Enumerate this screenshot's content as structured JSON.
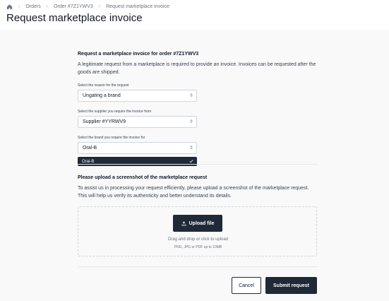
{
  "breadcrumb": {
    "items": [
      "Orders",
      "Order #7Z1YWV3",
      "Request marketplace invoice"
    ]
  },
  "page_title": "Request marketplace invoice",
  "form": {
    "heading": "Request a marketplace invoice for order #7Z1YWV3",
    "description": "A legitimate request from a marketplace is required to provide an invoice. Invoices can be requested after the goods are shipped.",
    "reason": {
      "label": "Select the reason for the request",
      "value": "Ungating a brand"
    },
    "supplier": {
      "label": "Select the supplier you require the invoice from",
      "value": "Supplier #YYRWV9"
    },
    "brand": {
      "label": "Select the brand you require the invoice for",
      "value": "Oral-B",
      "options": [
        {
          "label": "Oral-B",
          "selected": true
        }
      ]
    }
  },
  "upload": {
    "heading": "Please upload a screenshot of the marketplace request",
    "description": "To assist us in processing your request efficiently, please upload a screenshot of the marketplace request. This will help us verify its authenticity and better understand its details.",
    "button_label": "Upload file",
    "hint": "Drag and drop or click to upload",
    "formats": "PNG, JPG or PDF up to 10MB"
  },
  "actions": {
    "cancel_label": "Cancel",
    "submit_label": "Submit request"
  },
  "colors": {
    "primary": "#1f2937",
    "background": "#f9f9f9"
  },
  "icons": {
    "home": "home-icon",
    "separator": "chevron-right-icon",
    "select_caret": "chevron-up-down-icon",
    "selected": "check-icon",
    "upload": "upload-icon"
  }
}
